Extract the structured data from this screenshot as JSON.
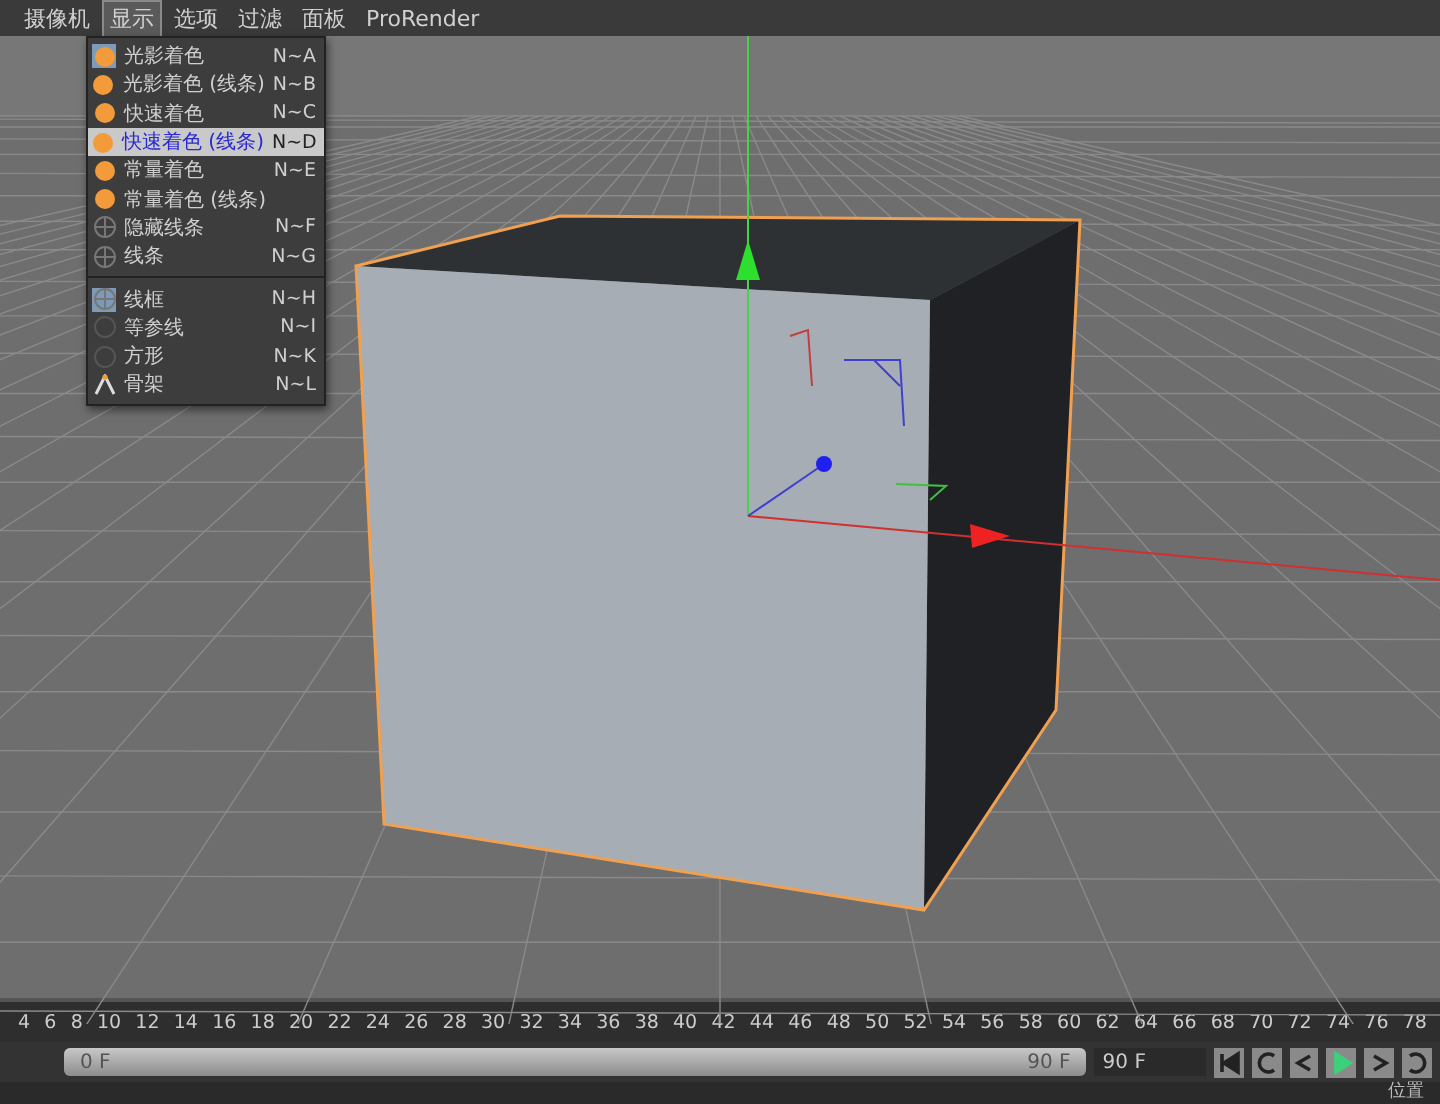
{
  "menubar": {
    "items": [
      {
        "label": "摄像机",
        "selected": false
      },
      {
        "label": "显示",
        "selected": true
      },
      {
        "label": "选项",
        "selected": false
      },
      {
        "label": "过滤",
        "selected": false
      },
      {
        "label": "面板",
        "selected": false
      },
      {
        "label": "ProRender",
        "selected": false
      }
    ]
  },
  "display_menu": {
    "items": [
      {
        "kind": "shaded",
        "label": "光影着色",
        "shortcut": "N~A",
        "active": true,
        "highlighted": false
      },
      {
        "kind": "shaded",
        "label": "光影着色 (线条)",
        "shortcut": "N~B",
        "active": false,
        "highlighted": false
      },
      {
        "kind": "shaded",
        "label": "快速着色",
        "shortcut": "N~C",
        "active": false,
        "highlighted": false
      },
      {
        "kind": "shaded",
        "label": "快速着色 (线条)",
        "shortcut": "N~D",
        "active": false,
        "highlighted": true
      },
      {
        "kind": "shaded",
        "label": "常量着色",
        "shortcut": "N~E",
        "active": false,
        "highlighted": false
      },
      {
        "kind": "shaded",
        "label": "常量着色 (线条)",
        "active": false,
        "highlighted": false
      },
      {
        "kind": "wire",
        "label": "隐藏线条",
        "shortcut": "N~F",
        "active": false,
        "highlighted": false
      },
      {
        "kind": "wire",
        "label": "线条",
        "shortcut": "N~G",
        "active": false,
        "highlighted": false
      },
      {
        "kind": "separator"
      },
      {
        "kind": "wire",
        "label": "线框",
        "shortcut": "N~H",
        "active": true,
        "highlighted": false
      },
      {
        "kind": "outline",
        "label": "等参线",
        "shortcut": "N~I",
        "active": false,
        "highlighted": false
      },
      {
        "kind": "outline",
        "label": "方形",
        "shortcut": "N~K",
        "active": false,
        "highlighted": false
      },
      {
        "kind": "skeleton",
        "label": "骨架",
        "shortcut": "N~L",
        "active": false,
        "highlighted": false
      }
    ]
  },
  "timeline": {
    "ticks": [
      "4",
      "6",
      "8",
      "10",
      "12",
      "14",
      "16",
      "18",
      "20",
      "22",
      "24",
      "26",
      "28",
      "30",
      "32",
      "34",
      "36",
      "38",
      "40",
      "42",
      "44",
      "46",
      "48",
      "50",
      "52",
      "54",
      "56",
      "58",
      "60",
      "62",
      "64",
      "66",
      "68",
      "70",
      "72",
      "74",
      "76",
      "78"
    ],
    "range": {
      "level": 1,
      "start": "0 F",
      "end": "90 F"
    },
    "end_field": "90 F",
    "controls": [
      {
        "kind": "first",
        "selected": false
      },
      {
        "kind": "loop",
        "selected": false
      },
      {
        "kind": "back",
        "selected": false
      },
      {
        "kind": "play",
        "selected": true
      },
      {
        "kind": "forward",
        "selected": false
      },
      {
        "kind": "repeat",
        "selected": false
      }
    ]
  },
  "attributes_tab": {
    "label": "位置"
  }
}
